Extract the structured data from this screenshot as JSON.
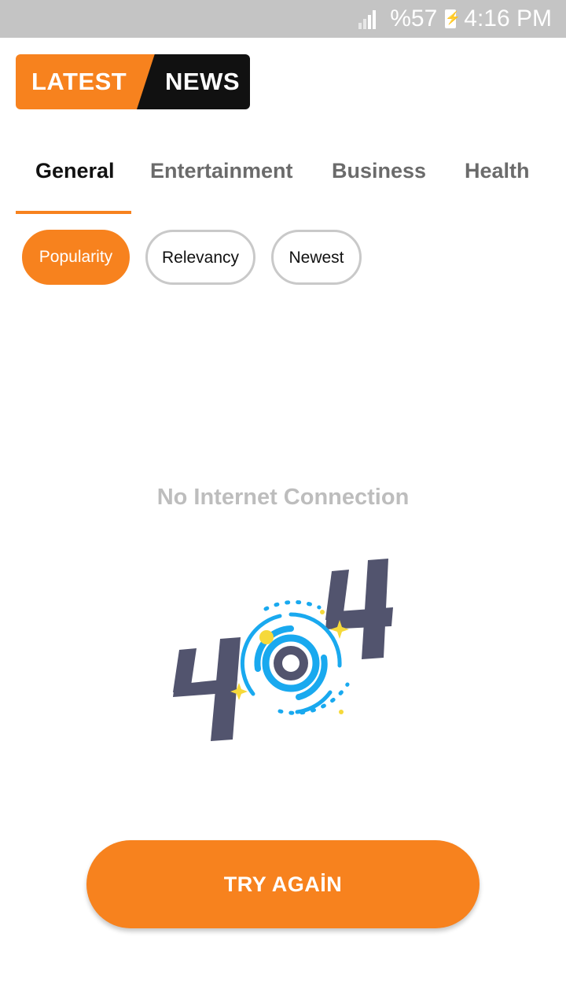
{
  "status_bar": {
    "battery_text": "%57",
    "time": "4:16 PM"
  },
  "logo": {
    "word1": "LATEST",
    "word2": "NEWS"
  },
  "tabs": [
    {
      "label": "General",
      "active": true
    },
    {
      "label": "Entertainment",
      "active": false
    },
    {
      "label": "Business",
      "active": false
    },
    {
      "label": "Health",
      "active": false
    }
  ],
  "sort_chips": [
    {
      "label": "Popularity",
      "selected": true
    },
    {
      "label": "Relevancy",
      "selected": false
    },
    {
      "label": "Newest",
      "selected": false
    }
  ],
  "error": {
    "message": "No Internet Connection",
    "illustration": "404-illustration"
  },
  "retry_button": {
    "label": "TRY AGAİN"
  },
  "colors": {
    "accent": "#f7821e",
    "statusbar": "#c4c4c4",
    "tab_inactive": "#6b6b6b",
    "message": "#bdbdbd",
    "illustration_dark": "#52546e",
    "illustration_blue": "#19a9ef",
    "illustration_yellow": "#f6d93a"
  }
}
